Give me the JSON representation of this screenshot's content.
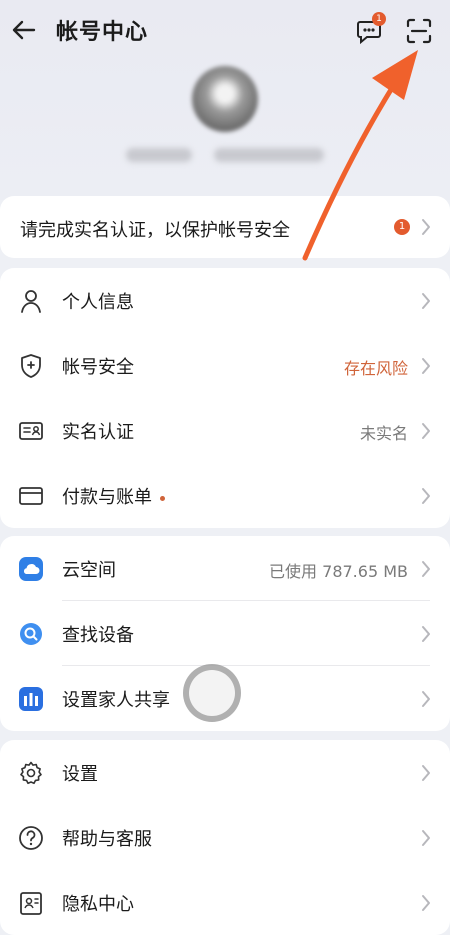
{
  "header": {
    "title": "帐号中心",
    "message_badge": "1"
  },
  "verify_banner": {
    "text": "请完成实名认证，以保护帐号安全",
    "badge": "1"
  },
  "group1": [
    {
      "label": "个人信息",
      "value": ""
    },
    {
      "label": "帐号安全",
      "value": "存在风险"
    },
    {
      "label": "实名认证",
      "value": "未实名"
    },
    {
      "label": "付款与账单",
      "value": ""
    }
  ],
  "group2": [
    {
      "label": "云空间",
      "value": "已使用 787.65 MB"
    },
    {
      "label": "查找设备",
      "value": ""
    },
    {
      "label": "设置家人共享",
      "value": ""
    }
  ],
  "group3": [
    {
      "label": "设置",
      "value": ""
    },
    {
      "label": "帮助与客服",
      "value": ""
    },
    {
      "label": "隐私中心",
      "value": ""
    }
  ],
  "colors": {
    "accent_orange": "#e35b2e",
    "risk_text": "#d0643a",
    "cloud_blue": "#2f7fe6"
  },
  "icons": {
    "back": "arrow-left-icon",
    "message": "message-bubble-icon",
    "scan": "scan-icon"
  }
}
